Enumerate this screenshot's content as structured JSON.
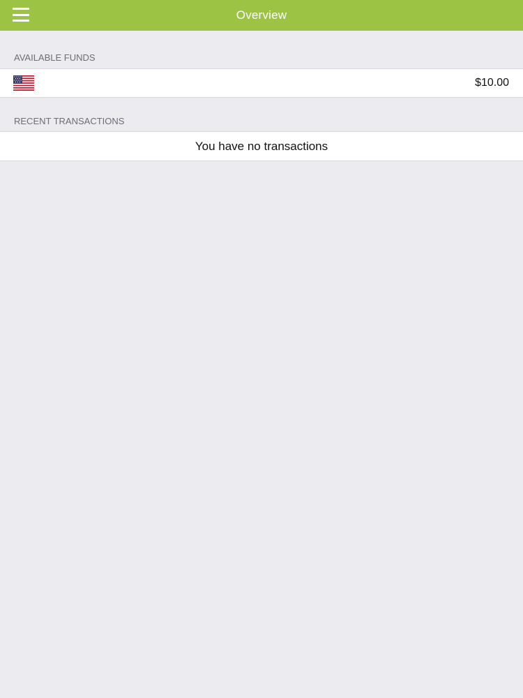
{
  "navbar": {
    "title": "Overview",
    "menu_icon": "hamburger-menu-icon",
    "background_color": "#9DC345"
  },
  "funds": {
    "header": "AVAILABLE FUNDS",
    "currency_flag_icon": "us-flag-icon",
    "amount": "$10.00"
  },
  "transactions": {
    "header": "RECENT TRANSACTIONS",
    "empty_message": "You have no transactions"
  }
}
